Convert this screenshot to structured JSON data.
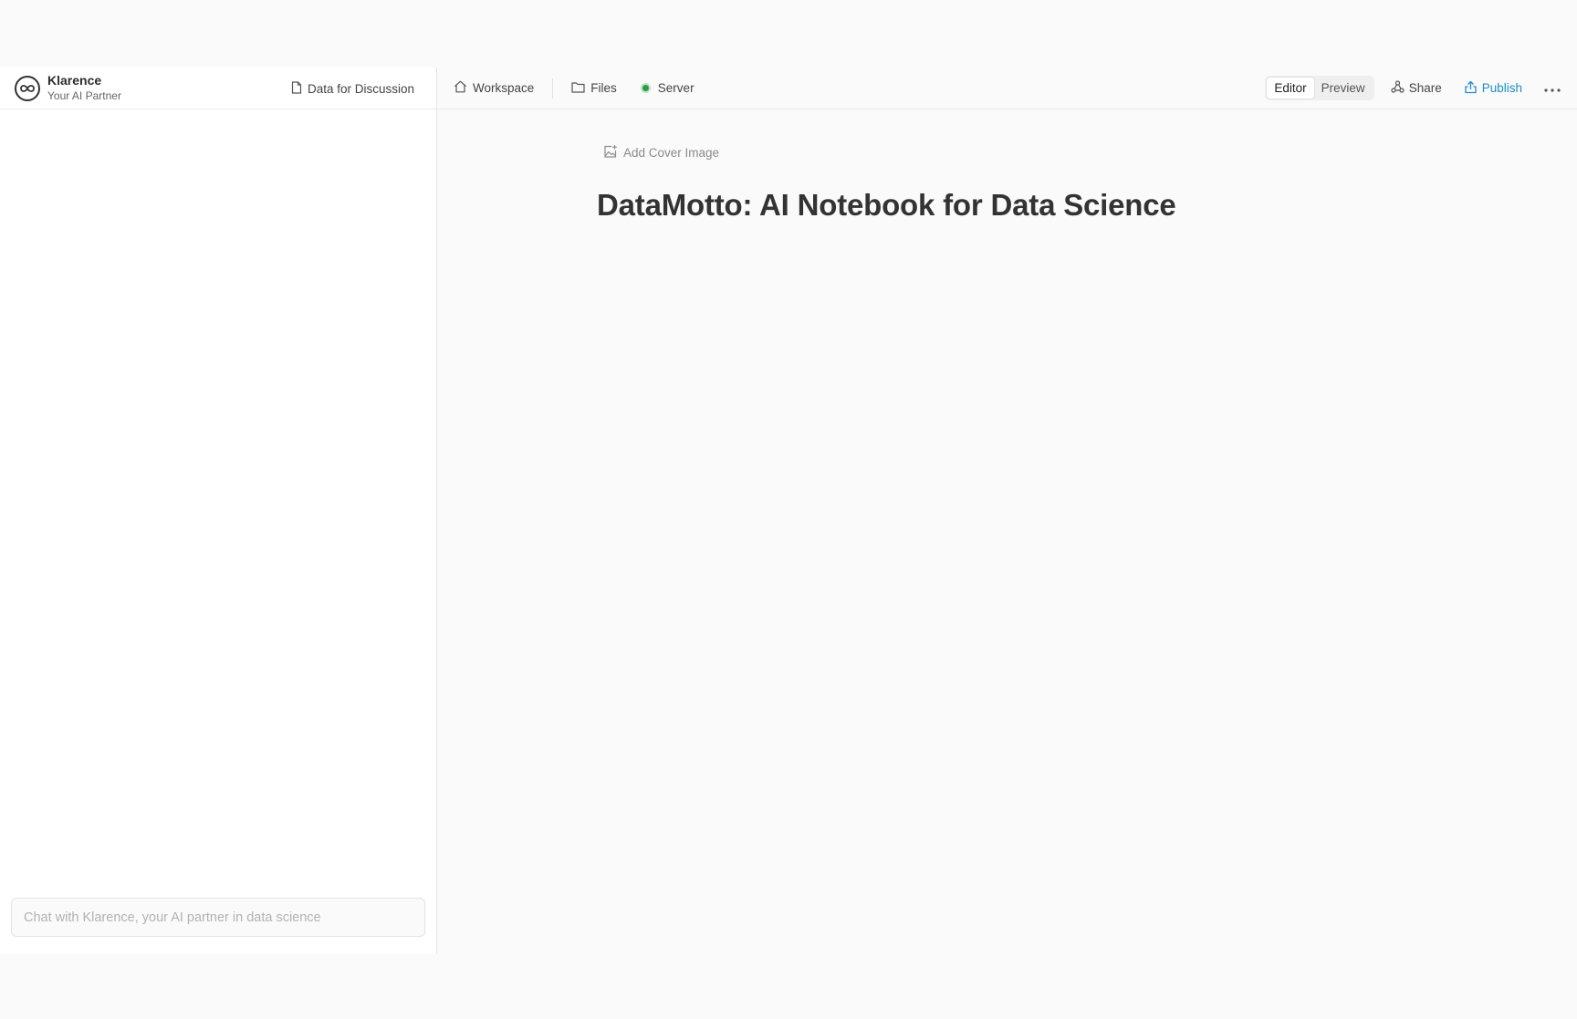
{
  "brand": {
    "name": "Klarence",
    "subtitle": "Your AI Partner"
  },
  "left_header": {
    "doc_link_label": "Data for Discussion"
  },
  "chat": {
    "placeholder": "Chat with Klarence, your AI partner in data science",
    "value": ""
  },
  "topbar": {
    "workspace_label": "Workspace",
    "files_label": "Files",
    "server_label": "Server",
    "server_status_color": "#2e9a4a",
    "mode_tabs": [
      {
        "label": "Editor",
        "active": true
      },
      {
        "label": "Preview",
        "active": false
      }
    ],
    "share_label": "Share",
    "publish_label": "Publish",
    "publish_color": "#1f8cc9"
  },
  "document": {
    "add_cover_label": "Add Cover Image",
    "title": "DataMotto: AI Notebook for Data Science"
  },
  "icons": {
    "logo": "infinity-logo-icon",
    "doc": "document-icon",
    "workspace": "home-icon",
    "files": "folder-icon",
    "share": "share-nodes-icon",
    "publish": "upload-icon",
    "more": "ellipsis-icon",
    "cover": "image-add-icon"
  }
}
